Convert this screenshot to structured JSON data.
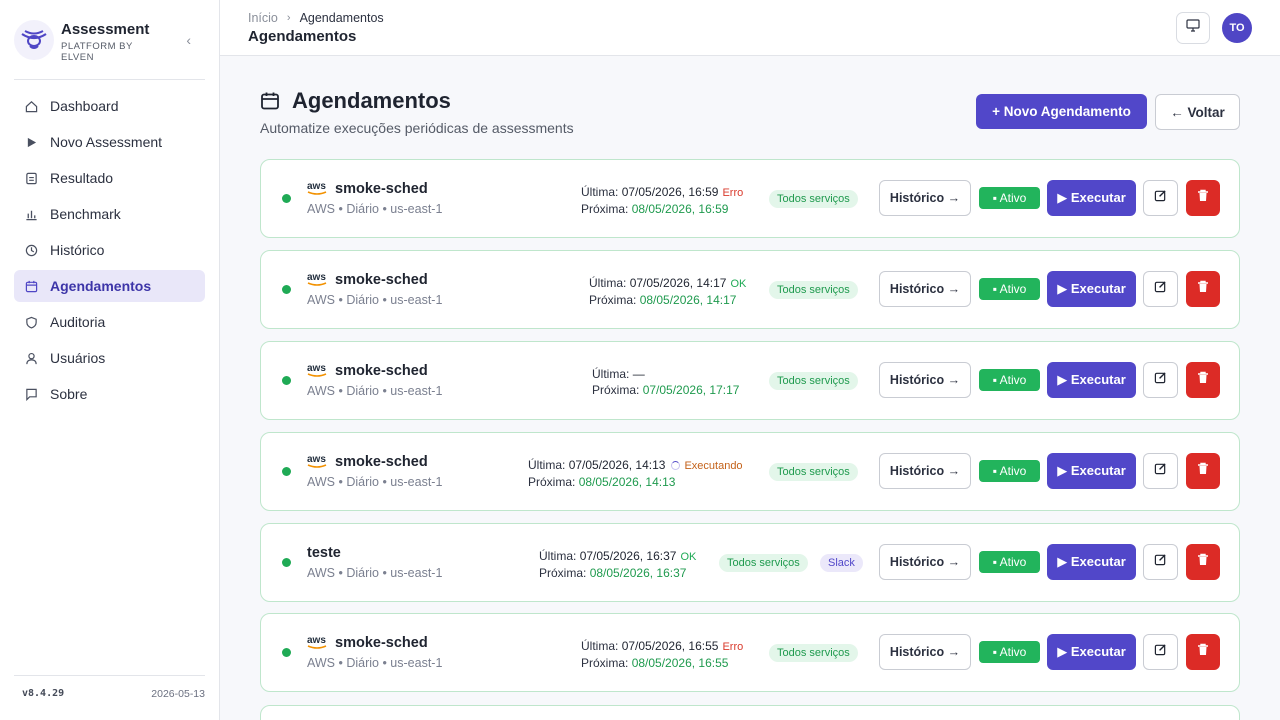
{
  "brand": {
    "title": "Assessment",
    "subtitle": "PLATFORM BY ELVEN"
  },
  "sidebar": {
    "items": [
      {
        "label": "Dashboard",
        "icon": "home-icon"
      },
      {
        "label": "Novo Assessment",
        "icon": "play-icon"
      },
      {
        "label": "Resultado",
        "icon": "clipboard-icon"
      },
      {
        "label": "Benchmark",
        "icon": "bar-chart-icon"
      },
      {
        "label": "Histórico",
        "icon": "clock-icon"
      },
      {
        "label": "Agendamentos",
        "icon": "calendar-icon",
        "active": true
      },
      {
        "label": "Auditoria",
        "icon": "shield-icon"
      },
      {
        "label": "Usuários",
        "icon": "user-icon"
      },
      {
        "label": "Sobre",
        "icon": "chat-icon"
      }
    ],
    "version": "v8.4.29",
    "date": "2026-05-13"
  },
  "topbar": {
    "breadcrumb": [
      "Início",
      "Agendamentos"
    ],
    "title": "Agendamentos",
    "avatar": "TO"
  },
  "page": {
    "title": "Agendamentos",
    "subtitle": "Automatize execuções periódicas de assessments",
    "new_button": "+ Novo Agendamento",
    "back_button": "← Voltar"
  },
  "labels": {
    "last": "Última:",
    "next": "Próxima:",
    "history": "Histórico →",
    "active": "▪ Ativo",
    "execute": "▶ Executar",
    "all_services": "Todos serviços"
  },
  "schedules": [
    {
      "name": "smoke-sched",
      "aws_logo": true,
      "meta": "AWS • Diário • us-east-1",
      "last": "07/05/2026, 16:59",
      "status": "Erro",
      "status_type": "err",
      "next": "08/05/2026, 16:59",
      "slack": false
    },
    {
      "name": "smoke-sched",
      "aws_logo": true,
      "meta": "AWS • Diário • us-east-1",
      "last": "07/05/2026, 14:17",
      "status": "OK",
      "status_type": "ok",
      "next": "08/05/2026, 14:17",
      "slack": false
    },
    {
      "name": "smoke-sched",
      "aws_logo": true,
      "meta": "AWS • Diário • us-east-1",
      "last": "—",
      "status": "",
      "status_type": "none",
      "next": "07/05/2026, 17:17",
      "slack": false
    },
    {
      "name": "smoke-sched",
      "aws_logo": true,
      "meta": "AWS • Diário • us-east-1",
      "last": "07/05/2026, 14:13",
      "status": "Executando",
      "status_type": "run",
      "next": "08/05/2026, 14:13",
      "slack": false
    },
    {
      "name": "teste",
      "aws_logo": false,
      "meta": "AWS • Diário • us-east-1",
      "last": "07/05/2026, 16:37",
      "status": "OK",
      "status_type": "ok",
      "next": "08/05/2026, 16:37",
      "slack": true,
      "slack_label": "Slack"
    },
    {
      "name": "smoke-sched",
      "aws_logo": true,
      "meta": "AWS • Diário • us-east-1",
      "last": "07/05/2026, 16:55",
      "status": "Erro",
      "status_type": "err",
      "next": "08/05/2026, 16:55",
      "slack": false
    }
  ],
  "colors": {
    "accent": "#5147c9",
    "success": "#22b45c",
    "danger": "#dc2b26"
  }
}
